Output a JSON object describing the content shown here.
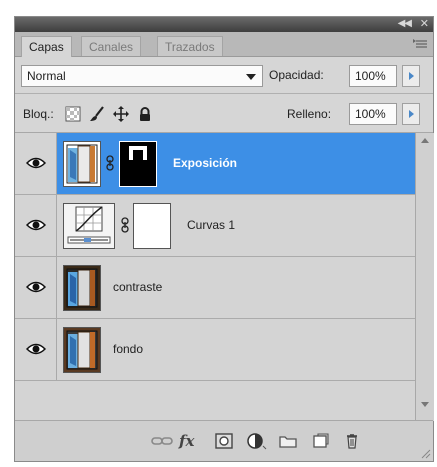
{
  "tabs": [
    {
      "label": "Capas",
      "active": true
    },
    {
      "label": "Canales",
      "active": false
    },
    {
      "label": "Trazados",
      "active": false
    }
  ],
  "blend_mode": "Normal",
  "opacity": {
    "label": "Opacidad:",
    "value": "100%"
  },
  "lock": {
    "label": "Bloq.:"
  },
  "fill": {
    "label": "Relleno:",
    "value": "100%"
  },
  "layers": [
    {
      "name": "Exposición",
      "selected": true,
      "visible": true
    },
    {
      "name": "Curvas 1",
      "selected": false,
      "visible": true
    },
    {
      "name": "contraste",
      "selected": false,
      "visible": true
    },
    {
      "name": "fondo",
      "selected": false,
      "visible": true
    }
  ],
  "colors": {
    "selection": "#3d8fe6",
    "panel": "#d6d6d6",
    "accent_arrow": "#4a88c8"
  },
  "bottom_icons": [
    "link-layers-icon",
    "fx-icon",
    "mask-icon",
    "adjustment-layer-icon",
    "group-folder-icon",
    "new-layer-icon",
    "trash-icon"
  ],
  "fx_label": "fx"
}
